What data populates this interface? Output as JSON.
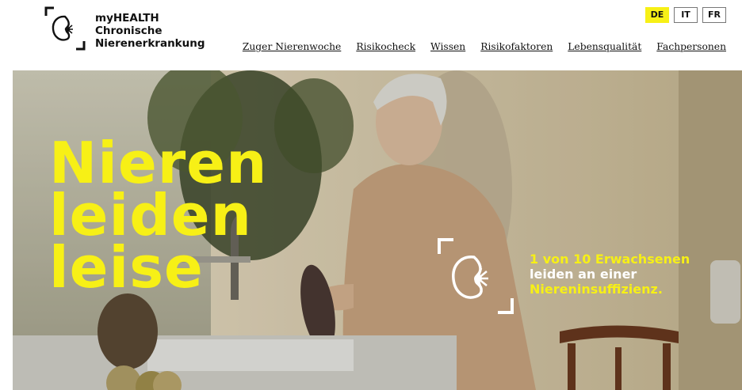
{
  "brand": {
    "line1": "myHEALTH",
    "line2": "Chronische",
    "line3": "Nierenerkrankung"
  },
  "languages": [
    {
      "label": "DE",
      "active": true
    },
    {
      "label": "IT",
      "active": false
    },
    {
      "label": "FR",
      "active": false
    }
  ],
  "nav": [
    "Zuger Nierenwoche",
    "Risikocheck",
    "Wissen",
    "Risikofaktoren",
    "Lebensqualität",
    "Fachpersonen"
  ],
  "hero": {
    "headline": [
      "Nieren",
      "leiden",
      "leise"
    ],
    "stat_line1": "1 von 10 Erwachsenen",
    "stat_line2": "leiden an einer",
    "stat_line3": "Niereninsuffizienz."
  },
  "colors": {
    "accent": "#f7f016",
    "text": "#111111"
  }
}
